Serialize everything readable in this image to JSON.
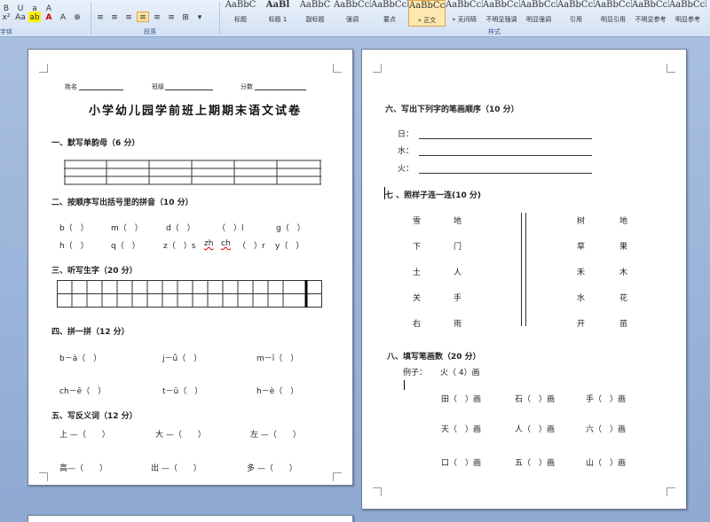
{
  "ribbon": {
    "tools_row1": [
      "x²",
      "Aa",
      "ab",
      "A",
      "A",
      "⊕"
    ],
    "para_row1": [
      "≡",
      "≡",
      "≡",
      "≡",
      "≡",
      "≡",
      "⊞",
      "▾"
    ],
    "groups": {
      "font": "字体",
      "paragraph": "段落",
      "styles": "样式"
    },
    "styles": [
      {
        "preview": "AaBbC",
        "name": "标题",
        "bold": false
      },
      {
        "preview": "AaBl",
        "name": "标题 1",
        "bold": true
      },
      {
        "preview": "AaBbC",
        "name": "副标题",
        "bold": false
      },
      {
        "preview": "AaBbCcDd",
        "name": "强调",
        "bold": false
      },
      {
        "preview": "AaBbCcDd",
        "name": "要点",
        "bold": false
      },
      {
        "preview": "AaBbCcDd",
        "name": "» 正文",
        "bold": false,
        "selected": true
      },
      {
        "preview": "AaBbCcDd",
        "name": "» 无间隔",
        "bold": false
      },
      {
        "preview": "AaBbCcDd",
        "name": "不明显强调",
        "bold": false
      },
      {
        "preview": "AaBbCcDd",
        "name": "明显强调",
        "bold": false
      },
      {
        "preview": "AaBbCcDd",
        "name": "引用",
        "bold": false
      },
      {
        "preview": "AaBbCcDd",
        "name": "明显引用",
        "bold": false
      },
      {
        "preview": "AaBbCcDd",
        "name": "不明显参考",
        "bold": false
      },
      {
        "preview": "AaBbCcDd",
        "name": "明显参考",
        "bold": false
      }
    ]
  },
  "p1": {
    "name_label": "姓名",
    "class_label": "班级",
    "score_label": "分数",
    "title": "小学幼儿园学前班上期期末语文试卷",
    "s1": "一、默写单韵母（6 分）",
    "s2": "二、按顺序写出括号里的拼音（10 分）",
    "s2_row1": [
      "b（　）",
      "m（　）",
      "d（　）",
      "（　）l",
      "g（　）"
    ],
    "s2_row2": [
      "h（　）",
      "q（　）",
      "z（　）s",
      "zh",
      "ch",
      "（　）r",
      "y（　）"
    ],
    "s3": "三、听写生字（20 分）",
    "s4": "四、拼一拼（12 分）",
    "s4_items": [
      "b－à（　）",
      "j－ǘ（　）",
      "m－ī（　）",
      "ch－ē（　）",
      "t－ū（　）",
      "h－è（　）"
    ],
    "s5": "五、写反义词（12 分）",
    "s5_items": [
      "上 —（　　）",
      "大 —（　　）",
      "左 —（　　）",
      "高—（　　）",
      "出 —（　　）",
      "多 —（　　）"
    ]
  },
  "p2": {
    "s6": "六、写出下列字的笔画顺序（10 分）",
    "s6_chars": [
      "日：",
      "水：",
      "火："
    ],
    "s7": "七 、照样子连一连(10 分)",
    "left_pairs": [
      [
        "雪",
        "地"
      ],
      [
        "下",
        "门"
      ],
      [
        "土",
        "人"
      ],
      [
        "关",
        "手"
      ],
      [
        "右",
        "雨"
      ]
    ],
    "right_pairs": [
      [
        "树",
        "地"
      ],
      [
        "草",
        "果"
      ],
      [
        "禾",
        "木"
      ],
      [
        "水",
        "花"
      ],
      [
        "开",
        "苗"
      ]
    ],
    "s8": "八、填写笔画数（20 分）",
    "example_label": "例子：",
    "example": "火（ 4）画",
    "s8_items": [
      [
        "田（　）画",
        "石（　）画",
        "手（　）画"
      ],
      [
        "天（　）画",
        "人（　）画",
        "六（　）画"
      ],
      [
        "口（　）画",
        "五（　）画",
        "山（　）画"
      ]
    ]
  }
}
